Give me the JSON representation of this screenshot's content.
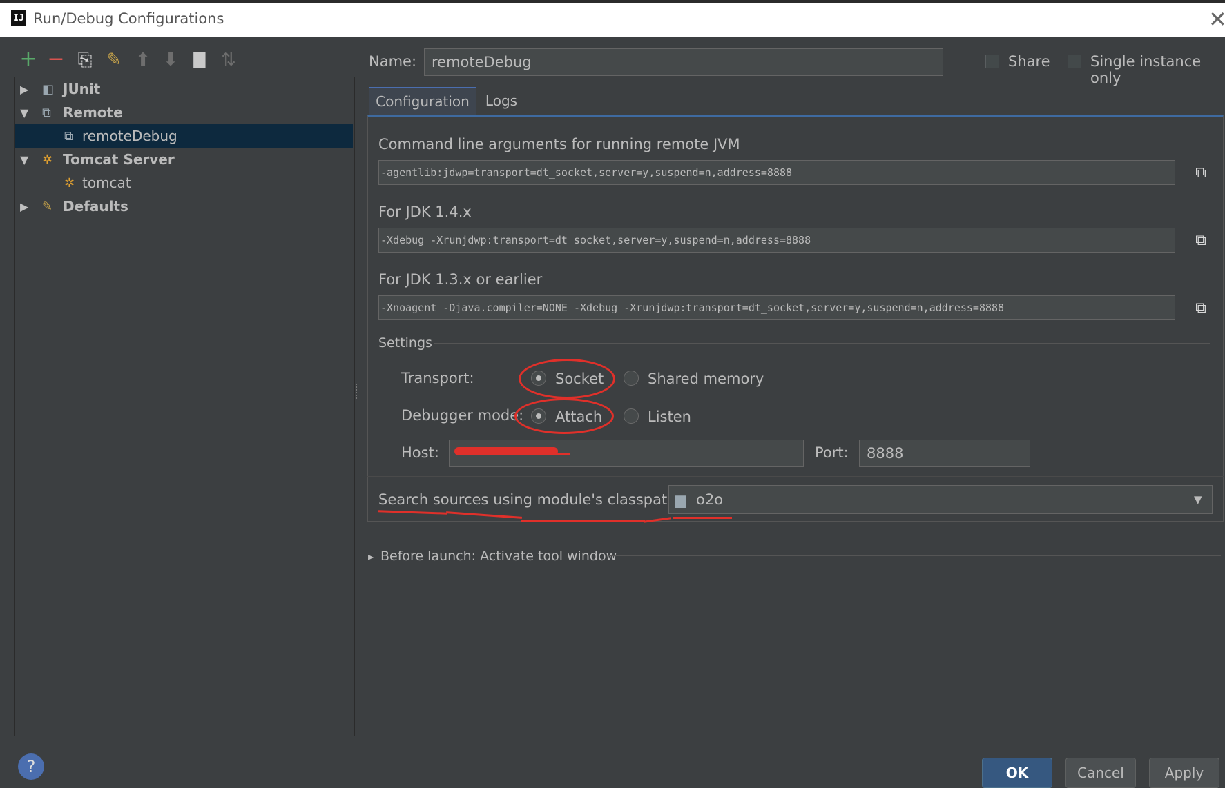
{
  "window": {
    "title": "Run/Debug Configurations",
    "close": "✕",
    "app_icon": "IJ"
  },
  "toolbar": {
    "icons": [
      "add-icon",
      "remove-icon",
      "copy-icon",
      "edit-defaults-icon",
      "move-up-icon",
      "move-down-icon",
      "folder-icon",
      "sort-icon"
    ],
    "glyphs": {
      "add": "+",
      "remove": "−",
      "copy": "⎘",
      "edit": "✎",
      "up": "⬆",
      "down": "⬇",
      "folder": "▇",
      "sort": "⇅"
    }
  },
  "tree": {
    "items": [
      {
        "label": "JUnit",
        "expanded": false
      },
      {
        "label": "Remote",
        "expanded": true
      },
      {
        "label": "remoteDebug",
        "selected": true
      },
      {
        "label": "Tomcat Server",
        "expanded": true
      },
      {
        "label": "tomcat"
      },
      {
        "label": "Defaults",
        "expanded": false
      }
    ],
    "arrow_collapsed": "▶",
    "arrow_expanded": "▼"
  },
  "header": {
    "name_label": "Name:",
    "name_value": "remoteDebug",
    "share_label": "Share",
    "single_instance_label": "Single instance only"
  },
  "tabs": [
    {
      "label": "Configuration",
      "active": true
    },
    {
      "label": "Logs",
      "active": false
    }
  ],
  "config": {
    "cmdline_label": "Command line arguments for running remote JVM",
    "cmdline_value": "-agentlib:jdwp=transport=dt_socket,server=y,suspend=n,address=8888",
    "jdk14_label": "For JDK 1.4.x",
    "jdk14_value": "-Xdebug -Xrunjdwp:transport=dt_socket,server=y,suspend=n,address=8888",
    "jdk13_label": "For JDK 1.3.x or earlier",
    "jdk13_value": "-Xnoagent -Djava.compiler=NONE -Xdebug -Xrunjdwp:transport=dt_socket,server=y,suspend=n,address=8888",
    "copy_glyph": "⧉",
    "settings_label": "Settings",
    "transport_label": "Transport:",
    "transport_options": [
      {
        "label": "Socket",
        "selected": true
      },
      {
        "label": "Shared memory",
        "selected": false
      }
    ],
    "debugger_mode_label": "Debugger mode:",
    "debugger_mode_options": [
      {
        "label": "Attach",
        "selected": true
      },
      {
        "label": "Listen",
        "selected": false
      }
    ],
    "host_label": "Host:",
    "host_value": "",
    "port_label": "Port:",
    "port_value": "8888",
    "module_label": "Search sources using module's classpath:",
    "module_value": "o2o",
    "dropdown_glyph": "▼"
  },
  "before_launch": {
    "label": "Before launch: Activate tool window",
    "arrow": "▸"
  },
  "footer": {
    "ok": "OK",
    "cancel": "Cancel",
    "apply": "Apply",
    "help": "?"
  },
  "colors": {
    "accent": "#4b6eaf",
    "annotation_red": "#e0302a",
    "selection": "#0d293e",
    "add_green": "#59a869",
    "remove_red": "#d9534f"
  }
}
